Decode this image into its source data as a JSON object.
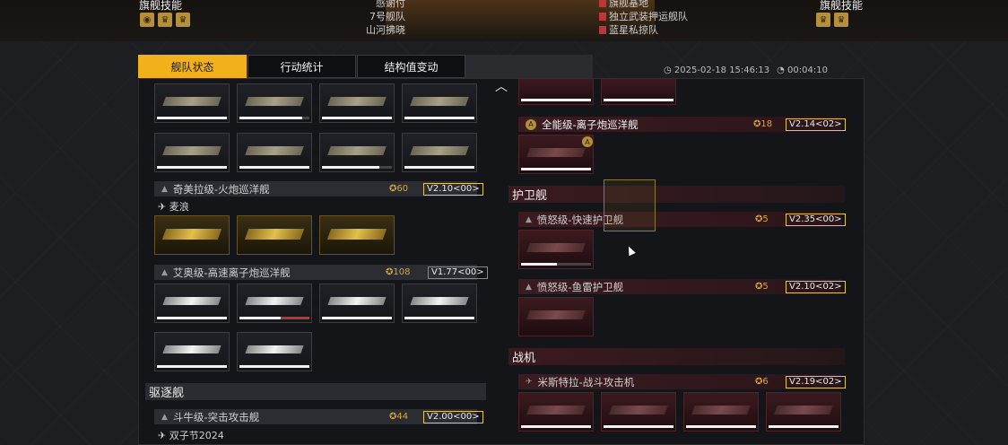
{
  "header": {
    "flag_skill_left": "旗舰技能",
    "flag_skill_right": "旗舰技能",
    "mid_lines": [
      "感谢付",
      "7号舰队",
      "山河拂晓"
    ],
    "right_lines": [
      "旗舰基地",
      "独立武装押运舰队",
      "蓝星私掠队"
    ]
  },
  "tabs": [
    {
      "label": "舰队状态",
      "active": true
    },
    {
      "label": "行动统计",
      "active": false
    },
    {
      "label": "结构值变动",
      "active": false
    }
  ],
  "status_bar": {
    "datetime": "◷ 2025-02-18 15:46:13",
    "timer": "◔ 00:04:10"
  },
  "left": {
    "ship_groups": [
      {
        "name": "奇美拉级-火炮巡洋舰",
        "count": "60",
        "version": "V2.10<00>",
        "pilot": "麦浪"
      },
      {
        "name": "艾奥级-高速离子炮巡洋舰",
        "count": "108",
        "version": "V1.77<00>"
      }
    ],
    "section_destroyer": "驱逐舰",
    "destroyer_group": {
      "name": "斗牛级-突击攻击舰",
      "count": "44",
      "version": "V2.00<00>",
      "pilot": "双子节2024"
    }
  },
  "right": {
    "cruiser_group": {
      "name": "全能级-离子炮巡洋舰",
      "count": "18",
      "version": "V2.14<02>"
    },
    "section_frigate": "护卫舰",
    "frigate_groups": [
      {
        "name": "愤怒级-快速护卫舰",
        "count": "5",
        "version": "V2.35<00>"
      },
      {
        "name": "愤怒级-鱼雷护卫舰",
        "count": "5",
        "version": "V2.10<02>"
      }
    ],
    "section_fighter": "战机",
    "fighter_group": {
      "name": "米斯特拉-战斗攻击机",
      "count": "6",
      "version": "V2.19<02>"
    }
  },
  "colors": {
    "accent": "#f2b01b",
    "gold": "#d9a440",
    "red_row": "#3a1b20"
  }
}
